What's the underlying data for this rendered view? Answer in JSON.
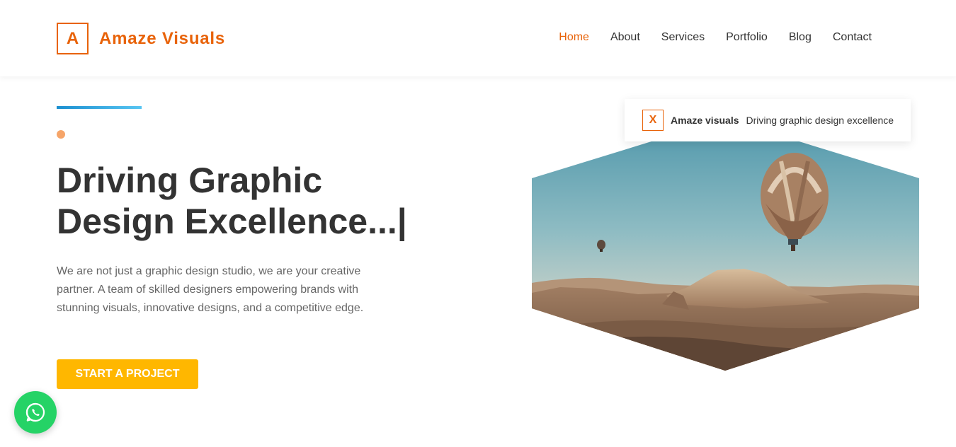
{
  "brand": {
    "logo_letter": "A",
    "name": "Amaze Visuals",
    "color": "#e8630a"
  },
  "nav": {
    "items": [
      {
        "label": "Home",
        "active": true
      },
      {
        "label": "About",
        "active": false
      },
      {
        "label": "Services",
        "active": false
      },
      {
        "label": "Portfolio",
        "active": false
      },
      {
        "label": "Blog",
        "active": false
      },
      {
        "label": "Contact",
        "active": false
      }
    ]
  },
  "hero": {
    "headline_line1": "Driving Graphic",
    "headline_line2": "Design Excellence...|",
    "description": "We are not just a graphic design studio, we are your creative partner. A team of skilled designers empowering brands with stunning visuals, innovative designs, and a competitive edge.",
    "cta_label": "START A PROJECT",
    "cta_color": "#ffb700",
    "image_icon": "hot-air-balloon-landscape-image"
  },
  "caption": {
    "letter": "X",
    "brand": "Amaze visuals",
    "text": "Driving graphic design excellence"
  },
  "floating": {
    "icon": "whatsapp-icon",
    "color": "#25d366"
  }
}
